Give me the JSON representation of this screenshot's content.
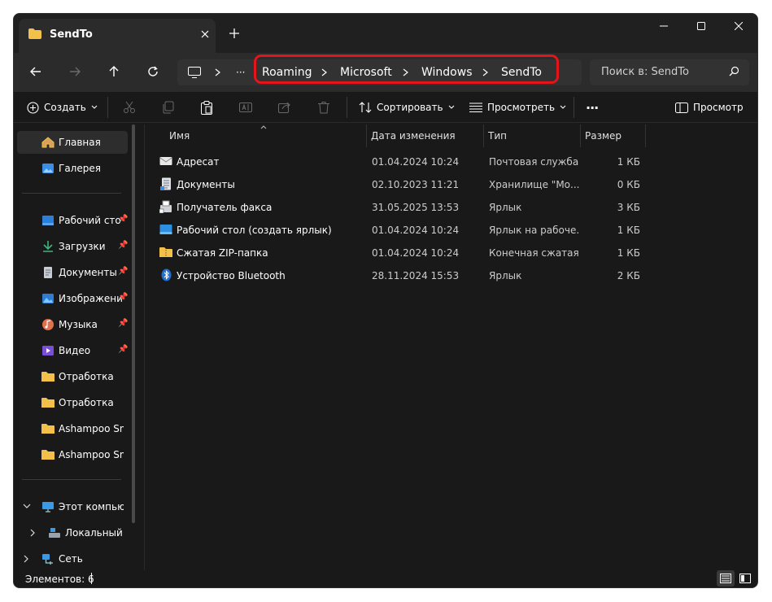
{
  "window": {
    "tab_title": "SendTo",
    "new_tab_label": "+"
  },
  "address": {
    "segments": [
      "Roaming",
      "Microsoft",
      "Windows",
      "SendTo"
    ],
    "overflow": "···"
  },
  "search": {
    "placeholder": "Поиск в: SendTo"
  },
  "commands": {
    "create": "Создать",
    "sort": "Сортировать",
    "view": "Просмотреть",
    "more": "···",
    "preview": "Просмотр"
  },
  "sidebar": {
    "items": [
      {
        "label": "Главная",
        "icon": "home-icon"
      },
      {
        "label": "Галерея",
        "icon": "gallery-icon"
      },
      {
        "label": "Рабочий сто",
        "icon": "desktop-icon",
        "pinned": true
      },
      {
        "label": "Загрузки",
        "icon": "download-icon",
        "pinned": true
      },
      {
        "label": "Документы",
        "icon": "documents-icon",
        "pinned": true
      },
      {
        "label": "Изображени",
        "icon": "pictures-icon",
        "pinned": true
      },
      {
        "label": "Музыка",
        "icon": "music-icon",
        "pinned": true
      },
      {
        "label": "Видео",
        "icon": "video-icon",
        "pinned": true
      },
      {
        "label": "Отработка",
        "icon": "folder-icon"
      },
      {
        "label": "Отработка",
        "icon": "folder-icon"
      },
      {
        "label": "Ashampoo Snap",
        "icon": "folder-icon"
      },
      {
        "label": "Ashampoo Snap",
        "icon": "folder-icon"
      },
      {
        "label": "Этот компьюте",
        "icon": "computer-icon"
      },
      {
        "label": "Локальный ди",
        "icon": "drive-icon"
      },
      {
        "label": "Сеть",
        "icon": "network-icon"
      }
    ]
  },
  "columns": {
    "name": "Имя",
    "date": "Дата изменения",
    "type": "Тип",
    "size": "Размер"
  },
  "files": [
    {
      "name": "Адресат",
      "date": "01.04.2024 10:24",
      "type": "Почтовая служба",
      "size": "1 КБ",
      "icon": "mail-recipient-icon"
    },
    {
      "name": "Документы",
      "date": "02.10.2023 11:21",
      "type": "Хранилище \"Мо...",
      "size": "0 КБ",
      "icon": "document-icon"
    },
    {
      "name": "Получатель факса",
      "date": "31.05.2025 13:53",
      "type": "Ярлык",
      "size": "3 КБ",
      "icon": "fax-icon"
    },
    {
      "name": "Рабочий стол (создать ярлык)",
      "date": "01.04.2024 10:24",
      "type": "Ярлык на рабоче...",
      "size": "1 КБ",
      "icon": "desktop-shortcut-icon"
    },
    {
      "name": "Сжатая ZIP-папка",
      "date": "01.04.2024 10:24",
      "type": "Конечная сжатая ...",
      "size": "1 КБ",
      "icon": "zip-folder-icon"
    },
    {
      "name": "Устройство Bluetooth",
      "date": "28.11.2024 15:53",
      "type": "Ярлык",
      "size": "2 КБ",
      "icon": "bluetooth-icon"
    }
  ],
  "status": {
    "count": "Элементов: 6"
  },
  "colors": {
    "highlight": "#e3151a",
    "folder": "#f3c04a",
    "background": "#191919"
  }
}
